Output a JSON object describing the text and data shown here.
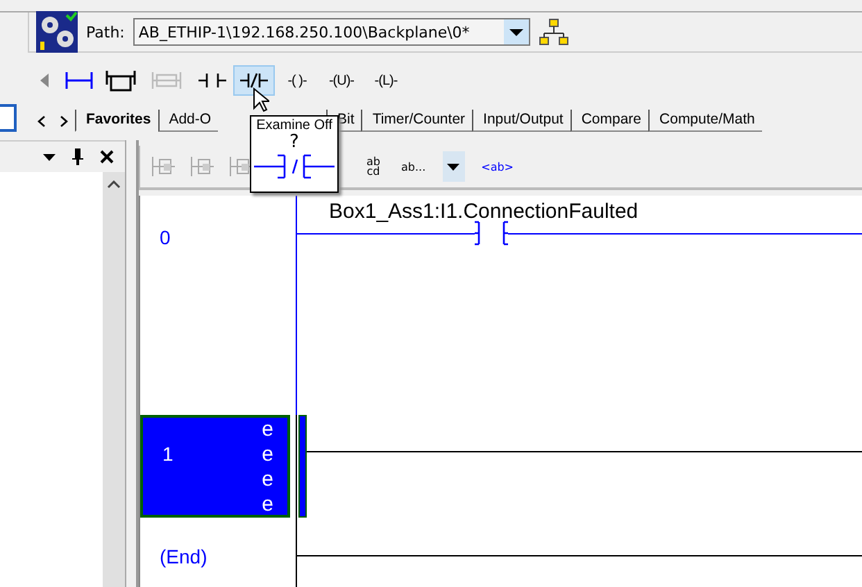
{
  "path_bar": {
    "label": "Path:",
    "value": "AB_ETHIP-1\\192.168.250.100\\Backplane\\0*"
  },
  "instruction_toolbar": [
    {
      "kind": "nav",
      "selected": false,
      "disabled": false
    },
    {
      "kind": "rung",
      "selected": false,
      "disabled": false
    },
    {
      "kind": "branch",
      "selected": false,
      "disabled": false
    },
    {
      "kind": "branch-level",
      "selected": false,
      "disabled": true
    },
    {
      "kind": "xic",
      "selected": false,
      "disabled": false
    },
    {
      "kind": "xio",
      "selected": true,
      "disabled": false
    },
    {
      "kind": "coil",
      "label": "-( )-",
      "selected": false,
      "disabled": false
    },
    {
      "kind": "coil",
      "label": "-(U)-",
      "selected": false,
      "disabled": false
    },
    {
      "kind": "coil",
      "label": "-(L)-",
      "selected": false,
      "disabled": false
    }
  ],
  "tabs": [
    {
      "label": "Favorites",
      "selected": true
    },
    {
      "label": "Add-O",
      "selected": false
    },
    {
      "label": "Bit",
      "selected": false
    },
    {
      "label": "Timer/Counter",
      "selected": false
    },
    {
      "label": "Input/Output",
      "selected": false
    },
    {
      "label": "Compare",
      "selected": false
    },
    {
      "label": "Compute/Math",
      "selected": false
    }
  ],
  "tooltip": {
    "title": "Examine Off",
    "symbol": "?"
  },
  "ladder_toolbar": [
    {
      "kind": "icon"
    },
    {
      "kind": "icon"
    },
    {
      "kind": "icon"
    },
    {
      "kind": "stack",
      "label": "ab cd"
    },
    {
      "kind": "text",
      "label": "ab..."
    },
    {
      "kind": "dropdown"
    },
    {
      "kind": "link",
      "label": "<ab>"
    }
  ],
  "rungs": [
    {
      "number": "0",
      "selected": false,
      "tag": "Box1_Ass1:I1.ConnectionFaulted",
      "kind": "xic"
    },
    {
      "number": "1",
      "selected": true,
      "kind": "empty",
      "errors": [
        "e",
        "e",
        "e",
        "e"
      ]
    }
  ],
  "end_label": "(End)"
}
